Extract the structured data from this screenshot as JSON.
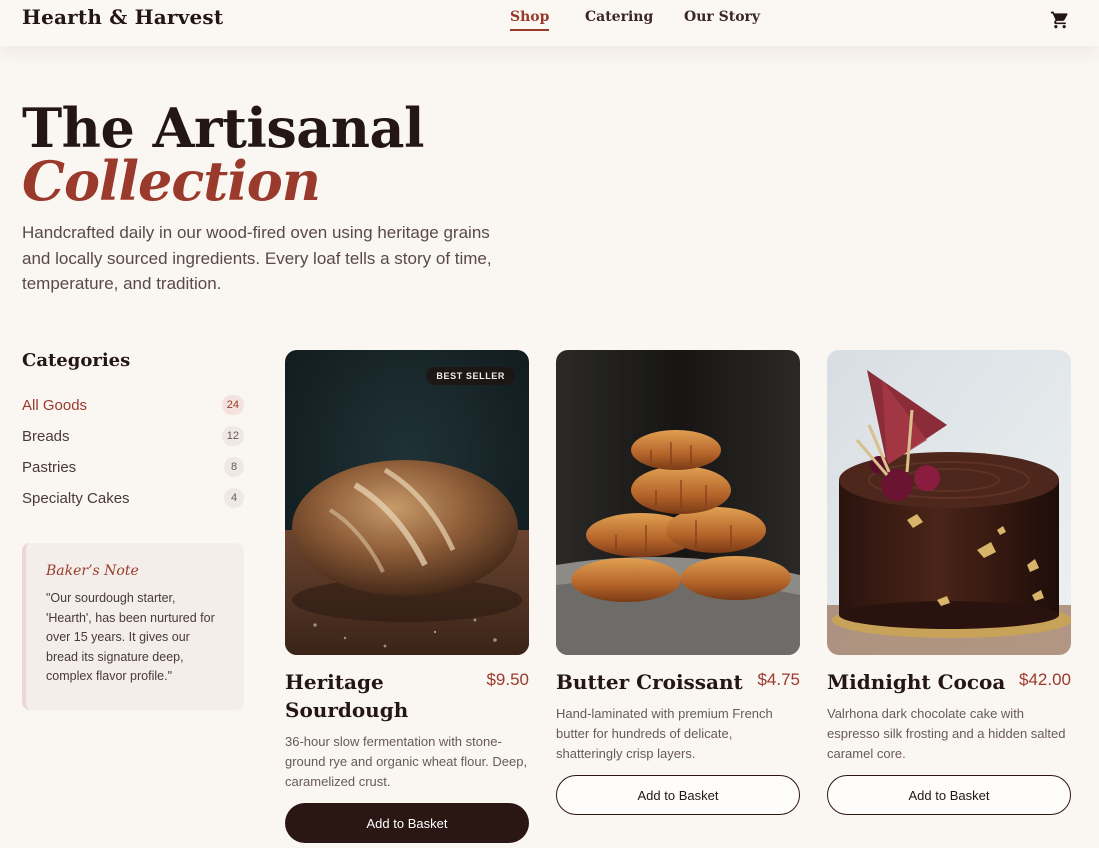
{
  "header": {
    "brand": "Hearth & Harvest",
    "nav": [
      "Shop",
      "Catering",
      "Our Story"
    ],
    "cart_icon": "cart-icon"
  },
  "hero": {
    "title": "The Artisanal",
    "accent": "Collection",
    "description": "Handcrafted daily in our wood-fired oven using heritage grains and locally sourced ingredients. Every loaf tells a story of time, temperature, and tradition."
  },
  "sidebar": {
    "title": "Categories",
    "items": [
      {
        "label": "All Goods",
        "count": "24"
      },
      {
        "label": "Breads",
        "count": "12"
      },
      {
        "label": "Pastries",
        "count": "8"
      },
      {
        "label": "Specialty Cakes",
        "count": "4"
      }
    ],
    "note": {
      "title": "Baker’s Note",
      "text": "\"Our sourdough starter, 'Hearth', has been nurtured for over 15 years. It gives our bread its signature deep, complex flavor profile.\""
    }
  },
  "products": [
    {
      "badge": "BEST SELLER",
      "name": "Heritage Sourdough",
      "price": "$9.50",
      "description": "36-hour slow fermentation with stone-ground rye and organic wheat flour. Deep, caramelized crust.",
      "button": "Add to Basket"
    },
    {
      "name": "Butter Croissant",
      "price": "$4.75",
      "description": "Hand-laminated with premium French butter for hundreds of delicate, shatteringly crisp layers.",
      "button": "Add to Basket"
    },
    {
      "name": "Midnight Cocoa",
      "price": "$42.00",
      "description": "Valrhona dark chocolate cake with espresso silk frosting and a hidden salted caramel core.",
      "button": "Add to Basket"
    }
  ],
  "colors": {
    "accent": "#9a3a2c",
    "dark": "#241614",
    "background": "#faf6f2"
  }
}
